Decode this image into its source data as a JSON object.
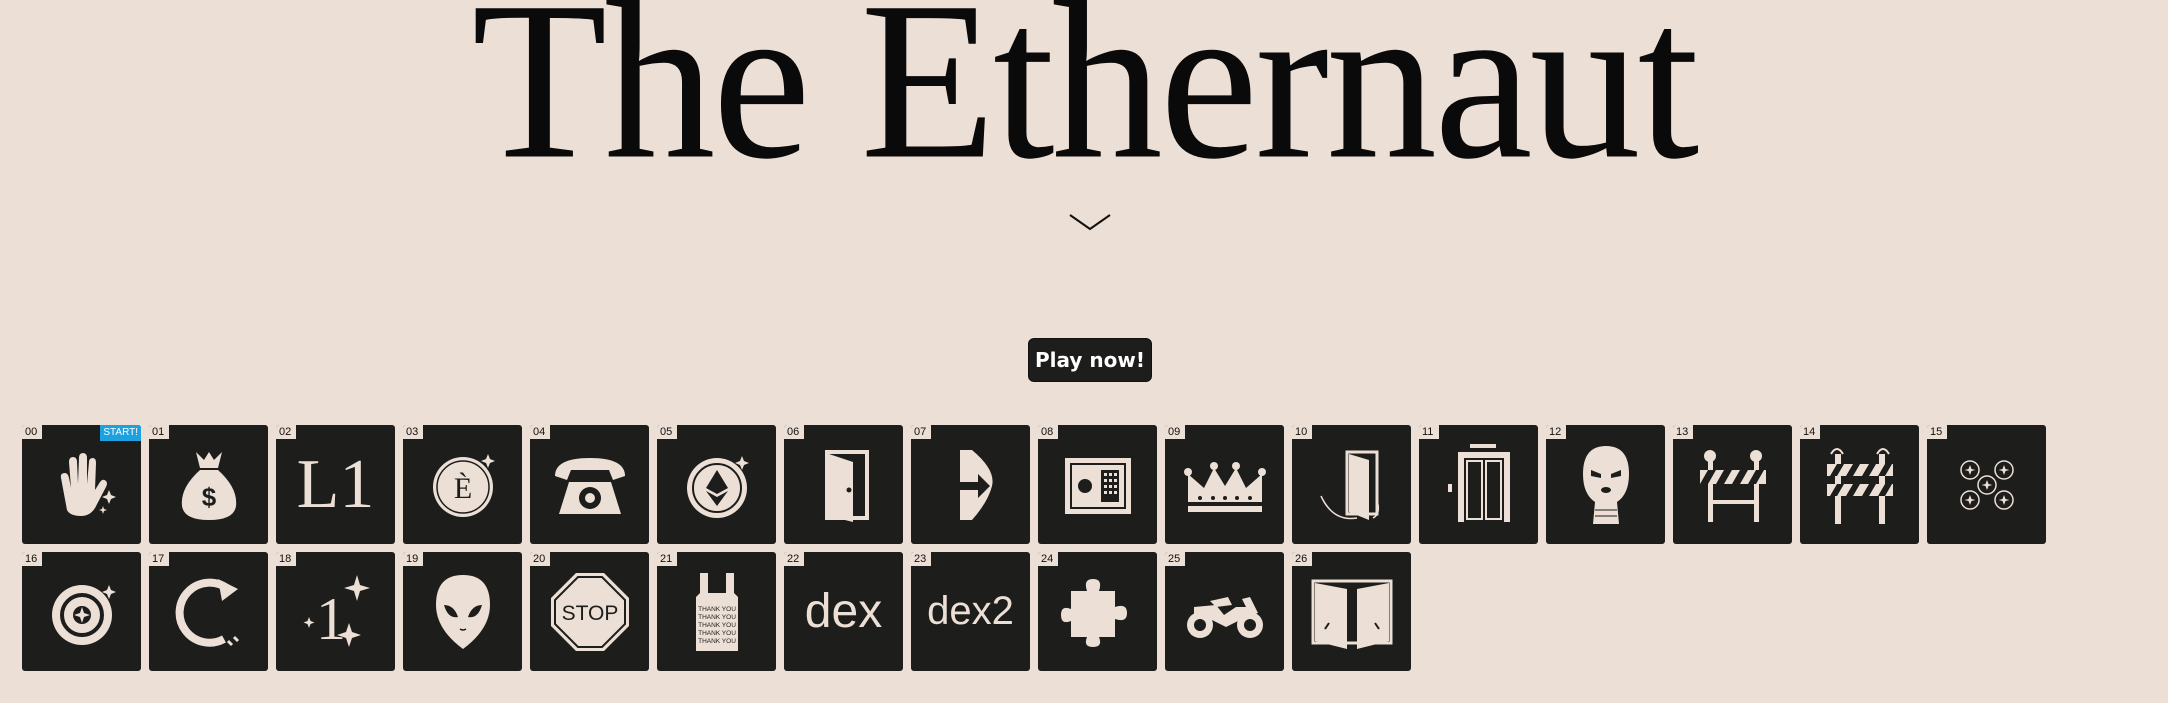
{
  "header": {
    "title": "The Ethernaut"
  },
  "play_button": {
    "label": "Play now!"
  },
  "start_badge": "START!",
  "levels": [
    {
      "num": "00",
      "icon": "hand-icon"
    },
    {
      "num": "01",
      "icon": "money-bag-icon"
    },
    {
      "num": "02",
      "icon": "l1-letters-icon",
      "text": "L1"
    },
    {
      "num": "03",
      "icon": "e-coin-icon",
      "text": "È"
    },
    {
      "num": "04",
      "icon": "telephone-icon"
    },
    {
      "num": "05",
      "icon": "ethereum-coin-icon"
    },
    {
      "num": "06",
      "icon": "open-door-icon"
    },
    {
      "num": "07",
      "icon": "arrow-door-icon"
    },
    {
      "num": "08",
      "icon": "safe-icon"
    },
    {
      "num": "09",
      "icon": "crown-icon"
    },
    {
      "num": "10",
      "icon": "swinging-door-icon"
    },
    {
      "num": "11",
      "icon": "elevator-icon"
    },
    {
      "num": "12",
      "icon": "balaclava-icon"
    },
    {
      "num": "13",
      "icon": "barrier-icon"
    },
    {
      "num": "14",
      "icon": "barrier-gate-icon"
    },
    {
      "num": "15",
      "icon": "coins-cluster-icon"
    },
    {
      "num": "16",
      "icon": "spinning-coin-icon"
    },
    {
      "num": "17",
      "icon": "refresh-arrow-icon"
    },
    {
      "num": "18",
      "icon": "sparkle-one-icon",
      "text": "1"
    },
    {
      "num": "19",
      "icon": "alien-icon"
    },
    {
      "num": "20",
      "icon": "stop-sign-icon",
      "text": "STOP"
    },
    {
      "num": "21",
      "icon": "thank-you-bag-icon",
      "text": "THANK YOU"
    },
    {
      "num": "22",
      "icon": "dex-text-icon",
      "text": "dex"
    },
    {
      "num": "23",
      "icon": "dex2-text-icon",
      "text": "dex2"
    },
    {
      "num": "24",
      "icon": "puzzle-piece-icon"
    },
    {
      "num": "25",
      "icon": "motorcycle-icon"
    },
    {
      "num": "26",
      "icon": "double-doors-icon"
    }
  ]
}
